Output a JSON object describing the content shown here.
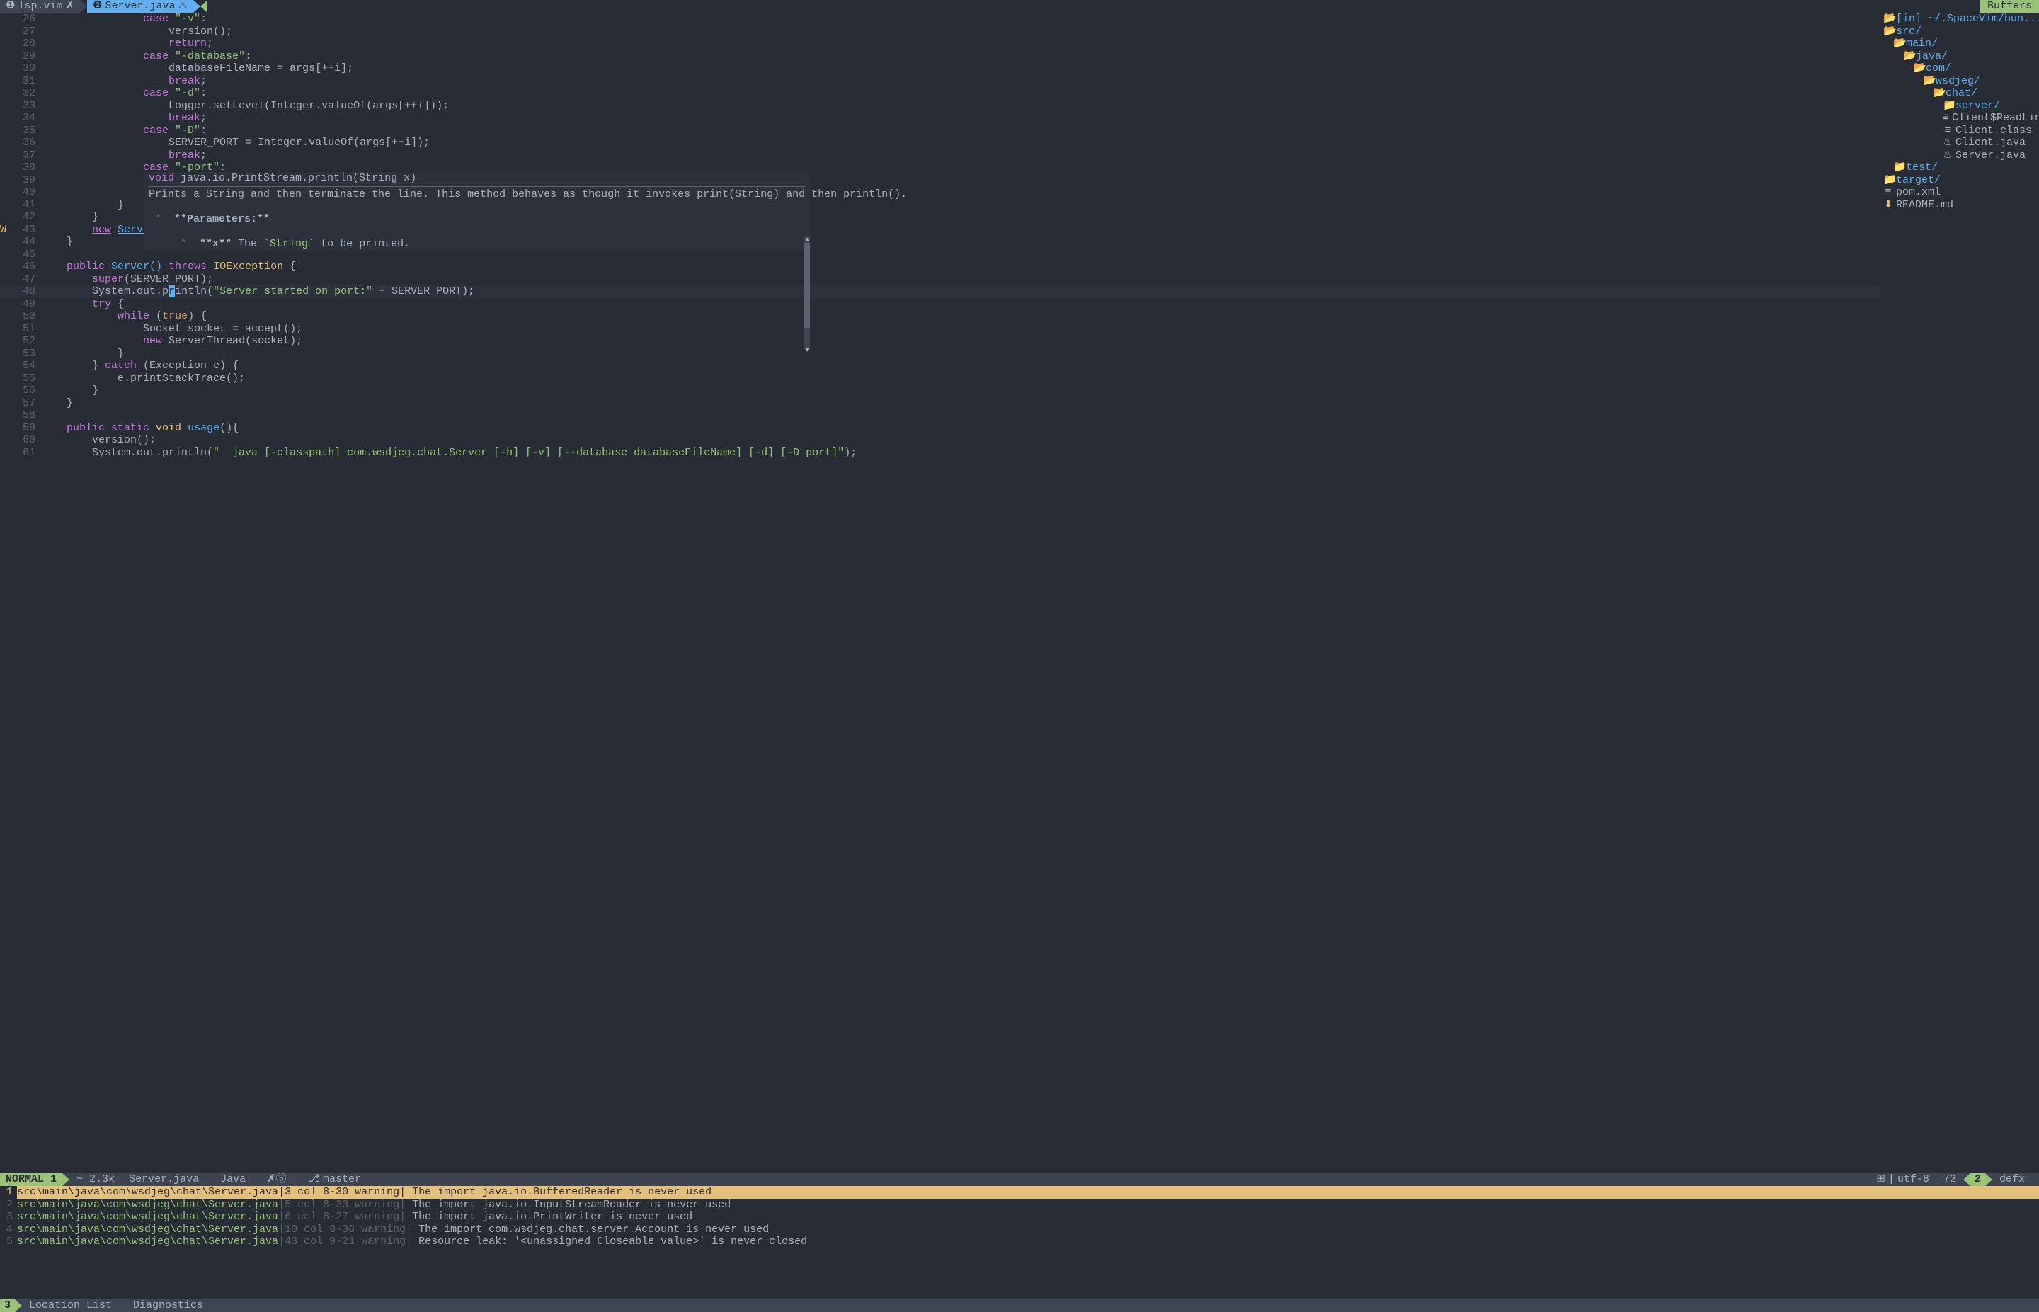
{
  "tabs": [
    {
      "num": "❶",
      "name": "lsp.vim",
      "icon": "✗"
    },
    {
      "num": "❷",
      "name": "Server.java",
      "icon": "♨"
    }
  ],
  "buffers_label": "Buffers",
  "code_lines": [
    {
      "n": "26",
      "indent": 16,
      "tokens": [
        {
          "t": "case ",
          "c": "kw"
        },
        {
          "t": "\"-v\"",
          "c": "str"
        },
        {
          "t": ":",
          "c": "op"
        }
      ]
    },
    {
      "n": "27",
      "indent": 20,
      "tokens": [
        {
          "t": "version();",
          "c": "op"
        }
      ]
    },
    {
      "n": "28",
      "indent": 20,
      "tokens": [
        {
          "t": "return",
          "c": "kw"
        },
        {
          "t": ";",
          "c": "op"
        }
      ]
    },
    {
      "n": "29",
      "indent": 16,
      "tokens": [
        {
          "t": "case ",
          "c": "kw"
        },
        {
          "t": "\"-database\"",
          "c": "str"
        },
        {
          "t": ":",
          "c": "op"
        }
      ]
    },
    {
      "n": "30",
      "indent": 20,
      "tokens": [
        {
          "t": "databaseFileName = args[++i];",
          "c": "op"
        }
      ]
    },
    {
      "n": "31",
      "indent": 20,
      "tokens": [
        {
          "t": "break",
          "c": "kw"
        },
        {
          "t": ";",
          "c": "op"
        }
      ]
    },
    {
      "n": "32",
      "indent": 16,
      "tokens": [
        {
          "t": "case ",
          "c": "kw"
        },
        {
          "t": "\"-d\"",
          "c": "str"
        },
        {
          "t": ":",
          "c": "op"
        }
      ]
    },
    {
      "n": "33",
      "indent": 20,
      "tokens": [
        {
          "t": "Logger.setLevel(Integer.valueOf(args[++i]));",
          "c": "op"
        }
      ]
    },
    {
      "n": "34",
      "indent": 20,
      "tokens": [
        {
          "t": "break",
          "c": "kw"
        },
        {
          "t": ";",
          "c": "op"
        }
      ]
    },
    {
      "n": "35",
      "indent": 16,
      "tokens": [
        {
          "t": "case ",
          "c": "kw"
        },
        {
          "t": "\"-D\"",
          "c": "str"
        },
        {
          "t": ":",
          "c": "op"
        }
      ]
    },
    {
      "n": "36",
      "indent": 20,
      "tokens": [
        {
          "t": "SERVER_PORT = Integer.valueOf(args[++i]);",
          "c": "op"
        }
      ]
    },
    {
      "n": "37",
      "indent": 20,
      "tokens": [
        {
          "t": "break",
          "c": "kw"
        },
        {
          "t": ";",
          "c": "op"
        }
      ]
    },
    {
      "n": "38",
      "indent": 16,
      "tokens": [
        {
          "t": "case ",
          "c": "kw"
        },
        {
          "t": "\"-port\"",
          "c": "str"
        },
        {
          "t": ":",
          "c": "op"
        }
      ]
    },
    {
      "n": "39",
      "indent": 0,
      "tokens": []
    },
    {
      "n": "40",
      "indent": 0,
      "tokens": []
    },
    {
      "n": "41",
      "indent": 12,
      "tokens": [
        {
          "t": "}",
          "c": "op"
        }
      ]
    },
    {
      "n": "42",
      "indent": 8,
      "tokens": [
        {
          "t": "}",
          "c": "op"
        }
      ]
    },
    {
      "n": "43",
      "sign": "W",
      "indent": 8,
      "tokens": [
        {
          "t": "new",
          "c": "underline-new"
        },
        {
          "t": " ",
          "c": "op"
        },
        {
          "t": "Server()",
          "c": "underline"
        }
      ]
    },
    {
      "n": "44",
      "indent": 4,
      "tokens": [
        {
          "t": "}",
          "c": "op"
        }
      ]
    },
    {
      "n": "45",
      "indent": 0,
      "tokens": []
    },
    {
      "n": "46",
      "indent": 4,
      "tokens": [
        {
          "t": "public ",
          "c": "kw"
        },
        {
          "t": "Server() ",
          "c": "fn"
        },
        {
          "t": "throws ",
          "c": "kw"
        },
        {
          "t": "IOException ",
          "c": "type"
        },
        {
          "t": "{",
          "c": "op"
        }
      ]
    },
    {
      "n": "47",
      "indent": 8,
      "tokens": [
        {
          "t": "super",
          "c": "kw"
        },
        {
          "t": "(SERVER_PORT);",
          "c": "op"
        }
      ]
    },
    {
      "n": "48",
      "indent": 8,
      "cursor": true,
      "tokens": [
        {
          "t": "System.out.p",
          "c": "op"
        },
        {
          "t": "r",
          "c": "cursor"
        },
        {
          "t": "intln(",
          "c": "op"
        },
        {
          "t": "\"Server started on port:\"",
          "c": "str"
        },
        {
          "t": " + SERVER_PORT);",
          "c": "op"
        }
      ]
    },
    {
      "n": "49",
      "indent": 8,
      "tokens": [
        {
          "t": "try ",
          "c": "kw"
        },
        {
          "t": "{",
          "c": "op"
        }
      ]
    },
    {
      "n": "50",
      "indent": 12,
      "tokens": [
        {
          "t": "while ",
          "c": "kw"
        },
        {
          "t": "(",
          "c": "op"
        },
        {
          "t": "true",
          "c": "const"
        },
        {
          "t": ") {",
          "c": "op"
        }
      ]
    },
    {
      "n": "51",
      "indent": 16,
      "tokens": [
        {
          "t": "Socket socket = accept();",
          "c": "op"
        }
      ]
    },
    {
      "n": "52",
      "indent": 16,
      "tokens": [
        {
          "t": "new ",
          "c": "kw"
        },
        {
          "t": "ServerThread(socket);",
          "c": "op"
        }
      ]
    },
    {
      "n": "53",
      "indent": 12,
      "tokens": [
        {
          "t": "}",
          "c": "op"
        }
      ]
    },
    {
      "n": "54",
      "indent": 8,
      "tokens": [
        {
          "t": "} ",
          "c": "op"
        },
        {
          "t": "catch ",
          "c": "kw"
        },
        {
          "t": "(Exception e) {",
          "c": "op"
        }
      ]
    },
    {
      "n": "55",
      "indent": 12,
      "tokens": [
        {
          "t": "e.printStackTrace();",
          "c": "op"
        }
      ]
    },
    {
      "n": "56",
      "indent": 8,
      "tokens": [
        {
          "t": "}",
          "c": "op"
        }
      ]
    },
    {
      "n": "57",
      "indent": 4,
      "tokens": [
        {
          "t": "}",
          "c": "op"
        }
      ]
    },
    {
      "n": "58",
      "indent": 0,
      "tokens": []
    },
    {
      "n": "59",
      "indent": 4,
      "tokens": [
        {
          "t": "public static ",
          "c": "kw"
        },
        {
          "t": "void ",
          "c": "type"
        },
        {
          "t": "usage",
          "c": "fn"
        },
        {
          "t": "(){",
          "c": "op"
        }
      ]
    },
    {
      "n": "60",
      "indent": 8,
      "tokens": [
        {
          "t": "version();",
          "c": "op"
        }
      ]
    },
    {
      "n": "61",
      "indent": 8,
      "tokens": [
        {
          "t": "System.out.println(",
          "c": "op"
        },
        {
          "t": "\"  java [-classpath] com.wsdjeg.chat.Server [-h] [-v] [--database databaseFileName] [-d] [-D port]\"",
          "c": "str"
        },
        {
          "t": ");",
          "c": "op"
        }
      ]
    }
  ],
  "hover": {
    "sig_void": "void",
    "sig_rest": " java.io.PrintStream.println(String x)",
    "desc": "Prints a String and then terminate the line. This method behaves as though it invokes print(String) and then println().",
    "params_label": "**Parameters:**",
    "param_star": " *  ",
    "param_x": "**x**",
    "param_desc": " The `String` to be printed."
  },
  "tree": [
    {
      "depth": 0,
      "icon": "📂",
      "name": "[in] ~/.SpaceVim/bun...tti",
      "type": "folder-open"
    },
    {
      "depth": 0,
      "icon": "📂",
      "name": "src/",
      "type": "folder-open"
    },
    {
      "depth": 1,
      "icon": "📂",
      "name": "main/",
      "type": "folder-open"
    },
    {
      "depth": 2,
      "icon": "📂",
      "name": "java/",
      "type": "folder-open"
    },
    {
      "depth": 3,
      "icon": "📂",
      "name": "com/",
      "type": "folder-open"
    },
    {
      "depth": 4,
      "icon": "📂",
      "name": "wsdjeg/",
      "type": "folder-open"
    },
    {
      "depth": 5,
      "icon": "📂",
      "name": "chat/",
      "type": "folder-open"
    },
    {
      "depth": 6,
      "icon": "📁",
      "name": "server/",
      "type": "folder-closed"
    },
    {
      "depth": 6,
      "icon": "≡",
      "name": "Client$ReadLineThre",
      "type": "file"
    },
    {
      "depth": 6,
      "icon": "≡",
      "name": "Client.class",
      "type": "file"
    },
    {
      "depth": 6,
      "icon": "♨",
      "name": "Client.java",
      "type": "file"
    },
    {
      "depth": 6,
      "icon": "♨",
      "name": "Server.java",
      "type": "file"
    },
    {
      "depth": 1,
      "icon": "📁",
      "name": "test/",
      "type": "folder-closed"
    },
    {
      "depth": 0,
      "icon": "📁",
      "name": "target/",
      "type": "folder-closed"
    },
    {
      "depth": 0,
      "icon": "≡",
      "name": "pom.xml",
      "type": "file"
    },
    {
      "depth": 0,
      "icon": "⬇",
      "name": "README.md",
      "type": "file-special"
    }
  ],
  "statusline": {
    "mode": "NORMAL",
    "winnum": "1",
    "size": "~ 2.3k",
    "filename": "Server.java",
    "filetype": "Java",
    "indicators": "✗Ⓢ",
    "branch_icon": "⎇",
    "branch": "master",
    "os_icon": "⊞",
    "encoding": "utf-8",
    "percent": "72",
    "winnum2": "2",
    "right_label": "defx"
  },
  "loclist": [
    {
      "n": "1",
      "path": "src\\main\\java\\com\\wsdjeg\\chat\\Server.java",
      "pos": "|3 col 8-30 warning|",
      "msg": " The import java.io.BufferedReader is never used",
      "selected": true
    },
    {
      "n": "2",
      "path": "src\\main\\java\\com\\wsdjeg\\chat\\Server.java",
      "pos": "|5 col 8-33 warning|",
      "msg": " The import java.io.InputStreamReader is never used"
    },
    {
      "n": "3",
      "path": "src\\main\\java\\com\\wsdjeg\\chat\\Server.java",
      "pos": "|6 col 8-27 warning|",
      "msg": " The import java.io.PrintWriter is never used"
    },
    {
      "n": "4",
      "path": "src\\main\\java\\com\\wsdjeg\\chat\\Server.java",
      "pos": "|10 col 8-38 warning|",
      "msg": " The import com.wsdjeg.chat.server.Account is never used"
    },
    {
      "n": "5",
      "path": "src\\main\\java\\com\\wsdjeg\\chat\\Server.java",
      "pos": "|43 col 9-21 warning|",
      "msg": " Resource leak: '<unassigned Closeable value>' is never closed"
    }
  ],
  "bottom": {
    "winnum": "3",
    "loclist": "Location List",
    "diag": "Diagnostics"
  }
}
